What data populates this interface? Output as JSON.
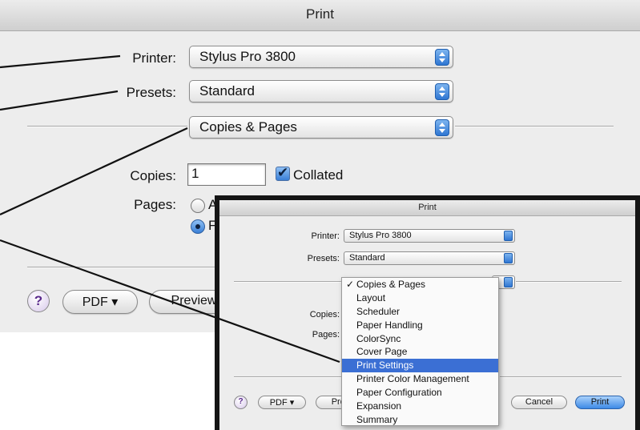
{
  "big": {
    "title": "Print",
    "printer_label": "Printer:",
    "printer_value": "Stylus Pro 3800",
    "presets_label": "Presets:",
    "presets_value": "Standard",
    "panel_value": "Copies & Pages",
    "copies_label": "Copies:",
    "copies_value": "1",
    "collated_label": "Collated",
    "pages_label": "Pages:",
    "pages_all_partial": "A",
    "pages_from_partial": "F",
    "help_label": "?",
    "pdf_label": "PDF ▾",
    "preview_label": "Preview"
  },
  "small": {
    "title": "Print",
    "printer_label": "Printer:",
    "printer_value": "Stylus Pro 3800",
    "presets_label": "Presets:",
    "presets_value": "Standard",
    "copies_label": "Copies:",
    "pages_label": "Pages:",
    "help_label": "?",
    "pdf_label": "PDF ▾",
    "preview_partial": "Prev",
    "cancel_label": "Cancel",
    "print_label": "Print"
  },
  "menu": {
    "check_mark": "✓",
    "items": [
      "Copies & Pages",
      "Layout",
      "Scheduler",
      "Paper Handling",
      "ColorSync",
      "Cover Page",
      "Print Settings",
      "Printer Color Management",
      "Paper Configuration",
      "Expansion",
      "Summary"
    ],
    "checked_index": 0,
    "selected_index": 6
  },
  "colors": {
    "selection": "#3b6fd4",
    "accent_blue": "#2f76d2",
    "leader_line": "#111111"
  }
}
